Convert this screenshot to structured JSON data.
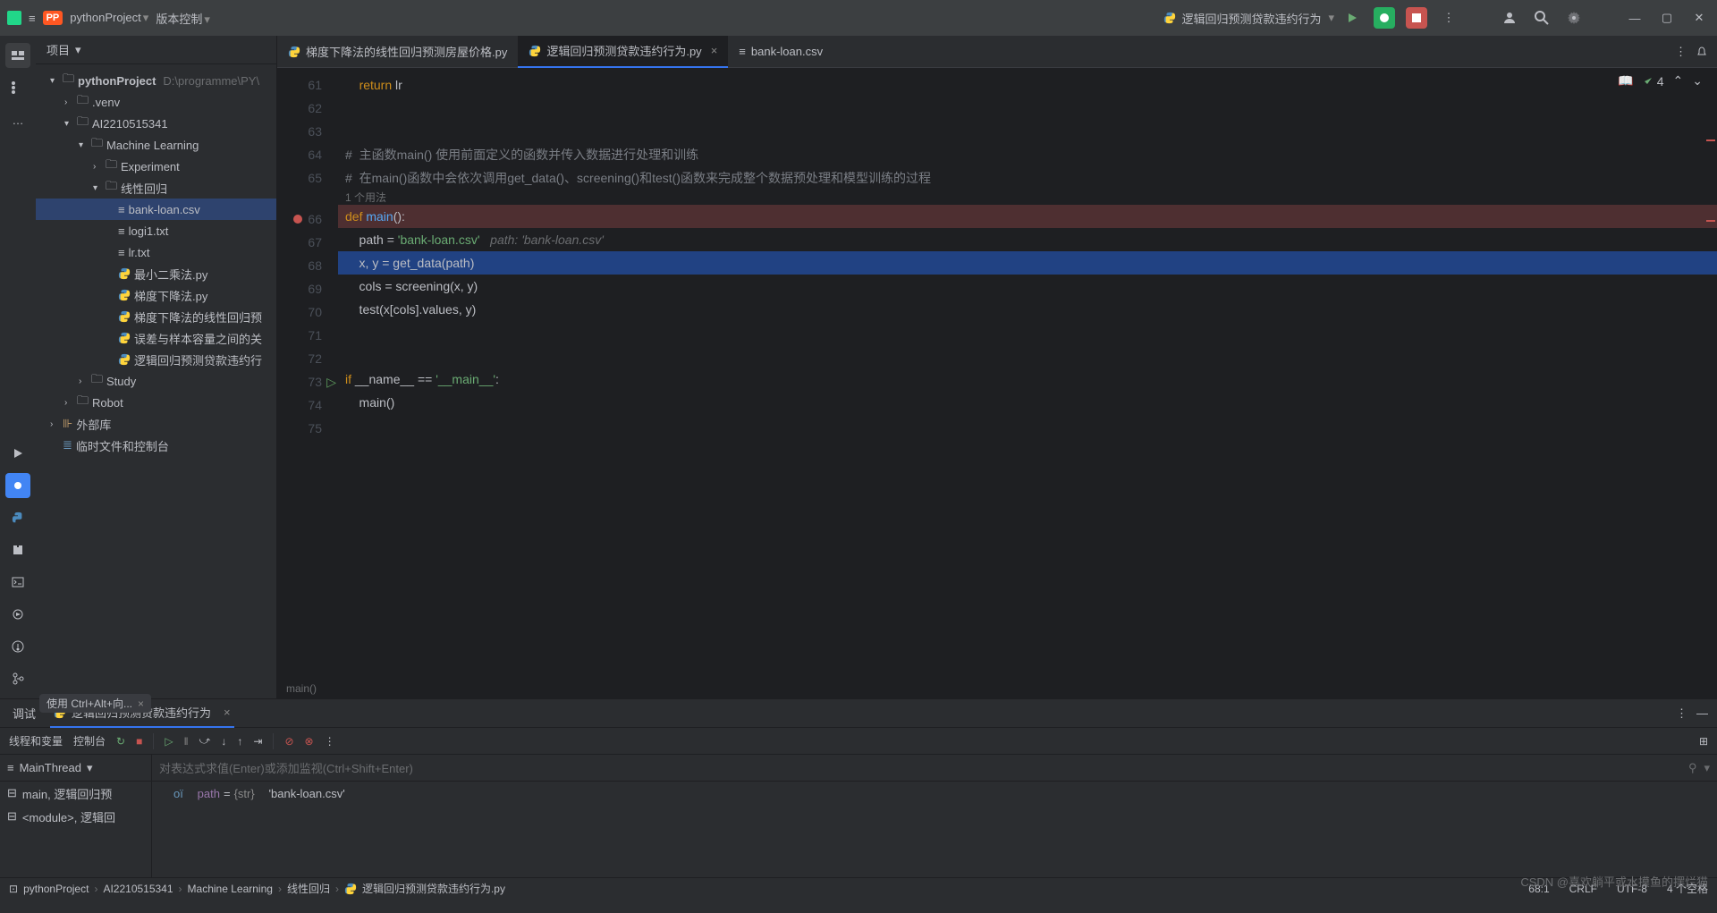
{
  "top": {
    "project_badge": "PP",
    "project_name": "pythonProject",
    "version_control": "版本控制",
    "run_config": "逻辑回归预测贷款违约行为"
  },
  "project_panel": {
    "title": "项目",
    "tree": {
      "root": "pythonProject",
      "root_path": "D:\\programme\\PY\\",
      "venv": ".venv",
      "ai_folder": "AI2210515341",
      "ml_folder": "Machine Learning",
      "experiment": "Experiment",
      "linreg": "线性回归",
      "bank_loan": "bank-loan.csv",
      "logi1": "logi1.txt",
      "lr_txt": "lr.txt",
      "py1": "最小二乘法.py",
      "py2": "梯度下降法.py",
      "py3": "梯度下降法的线性回归预",
      "py4": "误差与样本容量之间的关",
      "py5": "逻辑回归预测贷款违约行",
      "study": "Study",
      "robot": "Robot",
      "ext_lib": "外部库",
      "scratch": "临时文件和控制台"
    }
  },
  "editor": {
    "tabs": {
      "tab1": "梯度下降法的线性回归预测房屋价格.py",
      "tab2": "逻辑回归预测贷款违约行为.py",
      "tab3": "bank-loan.csv"
    },
    "problems": "4",
    "lines": {
      "l61_kw": "return",
      "l61_var": " lr",
      "l64": "#  主函数main() 使用前面定义的函数并传入数据进行处理和训练",
      "l65": "#  在main()函数中会依次调用get_data()、screening()和test()函数来完成整个数据预处理和模型训练的过程",
      "usage": "1 个用法",
      "l66_def": "def",
      "l66_fn": "main",
      "l66_rest": "():",
      "l67_a": "    path = ",
      "l67_str": "'bank-loan.csv'",
      "l67_hint": "   path: 'bank-loan.csv'",
      "l68": "    x, y = get_data(path)",
      "l69": "    cols = screening(x, y)",
      "l70": "    test(x[cols].values, y)",
      "l73_if": "if",
      "l73_a": " __name__ == ",
      "l73_str": "'__main__'",
      "l73_b": ":",
      "l74": "    main()"
    },
    "context": "main()"
  },
  "debug": {
    "title": "调试",
    "tab_name": "逻辑回归预测贷款违约行为",
    "vars_tab": "线程和变量",
    "console_tab": "控制台",
    "thread": "MainThread",
    "frame1": "main, 逻辑回归预",
    "frame2": "<module>, 逻辑回",
    "var_prompt": "对表达式求值(Enter)或添加监视(Ctrl+Shift+Enter)",
    "var_name": "path",
    "var_eq": " = ",
    "var_type": "{str}",
    "var_val": "'bank-loan.csv'"
  },
  "hint": {
    "text": "使用 Ctrl+Alt+向..."
  },
  "breadcrumb": {
    "p1": "pythonProject",
    "p2": "AI2210515341",
    "p3": "Machine Learning",
    "p4": "线性回归",
    "p5": "逻辑回归预测贷款违约行为.py"
  },
  "status": {
    "pos": "68:1",
    "eol": "CRLF",
    "enc": "UTF-8",
    "spaces": "4 个空格"
  },
  "watermark": "CSDN @喜欢躺平或水摸鱼的摆烂猫"
}
